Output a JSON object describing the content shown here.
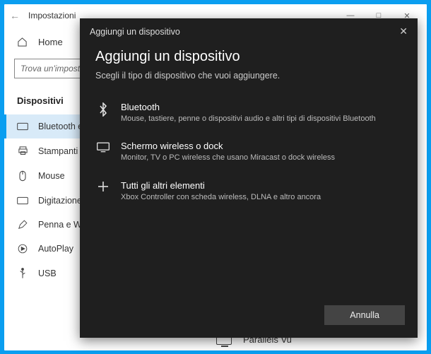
{
  "window": {
    "title": "Impostazioni",
    "search_placeholder": "Trova un'impostazione",
    "home_label": "Home",
    "category": "Dispositivi",
    "nav": [
      {
        "label": "Bluetooth e altri dispositivi"
      },
      {
        "label": "Stampanti e scanner"
      },
      {
        "label": "Mouse"
      },
      {
        "label": "Digitazione"
      },
      {
        "label": "Penna e Windows Ink"
      },
      {
        "label": "AutoPlay"
      },
      {
        "label": "USB"
      }
    ],
    "visible_device": "Parallels Vu"
  },
  "dialog": {
    "header": "Aggiungi un dispositivo",
    "title": "Aggiungi un dispositivo",
    "subtitle": "Scegli il tipo di dispositivo che vuoi aggiungere.",
    "options": [
      {
        "heading": "Bluetooth",
        "desc": "Mouse, tastiere, penne o dispositivi audio e altri tipi di dispositivi Bluetooth"
      },
      {
        "heading": "Schermo wireless o dock",
        "desc": "Monitor, TV o PC wireless che usano Miracast o dock wireless"
      },
      {
        "heading": "Tutti gli altri elementi",
        "desc": "Xbox Controller con scheda wireless, DLNA e altro ancora"
      }
    ],
    "cancel": "Annulla"
  }
}
